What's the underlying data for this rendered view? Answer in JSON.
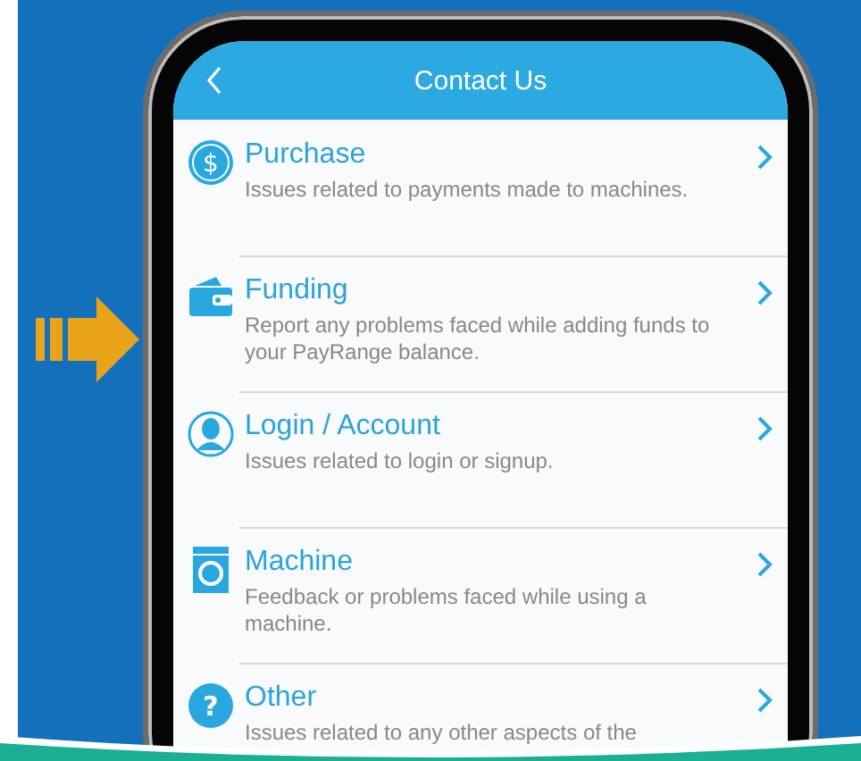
{
  "header": {
    "title": "Contact Us"
  },
  "items": [
    {
      "kind": "dollar",
      "glyph": "$",
      "title": "Purchase",
      "description": "Issues related to payments made to machines."
    },
    {
      "kind": "wallet",
      "title": "Funding",
      "description": "Report any problems faced while adding funds to your PayRange balance."
    },
    {
      "kind": "person",
      "title": "Login / Account",
      "description": "Issues related to login or signup."
    },
    {
      "kind": "washer",
      "title": "Machine",
      "description": "Feedback or problems faced while using a machine."
    },
    {
      "kind": "question",
      "glyph": "?",
      "title": "Other",
      "description": "Issues related to any other aspects of the"
    }
  ]
}
